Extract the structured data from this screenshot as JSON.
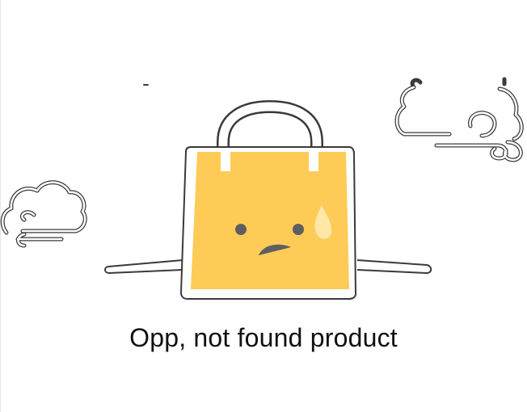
{
  "empty_state": {
    "message": "Opp, not found product",
    "illustration_icon": "sad-shopping-bag-icon"
  },
  "colors": {
    "bag_fill": "#FFCB57",
    "outline": "#3a3a3a",
    "face": "#5f5f5f",
    "sweat_drop": "#FFE7A8",
    "text": "#111111"
  }
}
